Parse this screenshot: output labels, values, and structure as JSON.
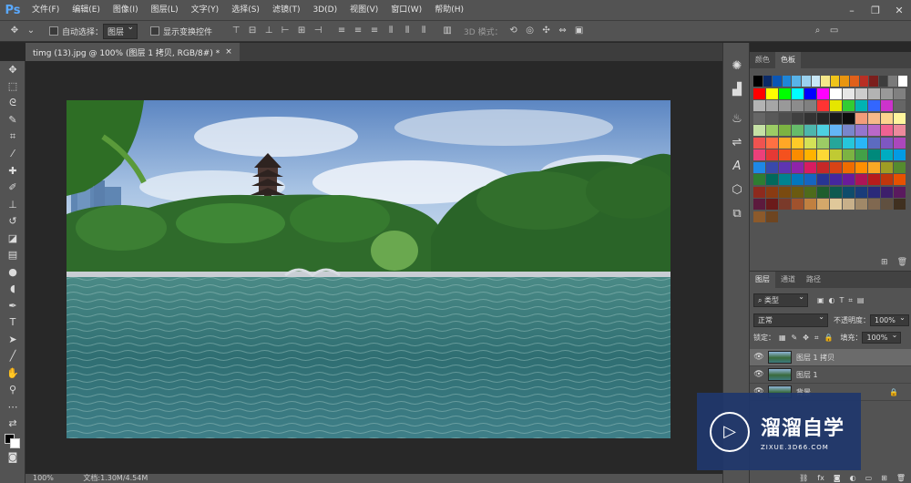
{
  "app": {
    "logo": "Ps"
  },
  "menu": [
    "文件(F)",
    "编辑(E)",
    "图像(I)",
    "图层(L)",
    "文字(Y)",
    "选择(S)",
    "滤镜(T)",
    "3D(D)",
    "视图(V)",
    "窗口(W)",
    "帮助(H)"
  ],
  "options": {
    "auto_select_label": "自动选择：",
    "auto_select_value": "图层",
    "show_transform_label": "显示变换控件",
    "mode_3d_label": "3D 模式："
  },
  "document": {
    "tab_title": "timg (13).jpg @ 100% (图层 1 拷贝, RGB/8#) *",
    "close": "×"
  },
  "status": {
    "zoom": "100%",
    "doc_info": "文档:1.30M/4.54M"
  },
  "swatch_panel": {
    "tabs": [
      "颜色",
      "色板"
    ],
    "active_tab": "色板"
  },
  "swatch_colors": [
    [
      "#000000",
      "#0b2a66",
      "#0a56b5",
      "#1e86d8",
      "#58b3e8",
      "#9ad1ee",
      "#c9e7f6",
      "#f5e78a",
      "#f0c419",
      "#e8950f",
      "#e0601a",
      "#b92f24",
      "#7b1f1d",
      "#3d3d3d",
      "#7a7a7a",
      "#ffffff"
    ],
    [
      "#ff0000",
      "#ffff00",
      "#00ff00",
      "#00ffff",
      "#0000ff",
      "#ff00ff",
      "#ffffff",
      "#e6e6e6",
      "#cccccc",
      "#b3b3b3",
      "#999999",
      "#808080"
    ],
    [
      "#b3b3b3",
      "#a6a6a6",
      "#999999",
      "#8c8c8c",
      "#808080",
      "#ff3333",
      "#e6e600",
      "#33cc33",
      "#00b3b3",
      "#3366ff",
      "#cc33cc",
      "#666666"
    ],
    [
      "#666666",
      "#595959",
      "#4d4d4d",
      "#404040",
      "#333333",
      "#262626",
      "#1a1a1a",
      "#0d0d0d",
      "#f29c7a",
      "#f7b98a",
      "#fcd48e",
      "#fff59d"
    ],
    [
      "#c5e1a5",
      "#9ccc65",
      "#7cb342",
      "#66bb6a",
      "#4db6ac",
      "#4dd0e1",
      "#64b5f6",
      "#7986cb",
      "#9575cd",
      "#ba68c8",
      "#f06292",
      "#ec8a9c"
    ],
    [
      "#ef5350",
      "#ff7043",
      "#ffa726",
      "#ffca28",
      "#d4e157",
      "#9ccc65",
      "#26a69a",
      "#26c6da",
      "#29b6f6",
      "#5c6bc0",
      "#7e57c2",
      "#ab47bc"
    ],
    [
      "#ec407a",
      "#e53935",
      "#f4511e",
      "#fb8c00",
      "#ffb300",
      "#fdd835",
      "#c0ca33",
      "#7cb342",
      "#43a047",
      "#00897b",
      "#00acc1",
      "#039be5"
    ],
    [
      "#1e88e5",
      "#3949ab",
      "#5e35b1",
      "#8e24aa",
      "#d81b60",
      "#c62828",
      "#d84315",
      "#ef6c00",
      "#ff8f00",
      "#f9a825",
      "#9e9d24",
      "#558b2f"
    ],
    [
      "#2e7d32",
      "#00695c",
      "#00838f",
      "#0277bd",
      "#1565c0",
      "#283593",
      "#4527a0",
      "#6a1b9a",
      "#ad1457",
      "#b71c1c",
      "#bf360c",
      "#e65100"
    ],
    [
      "#8d2a1e",
      "#8a3b12",
      "#7a4a10",
      "#6b5a10",
      "#4e6b1b",
      "#1f5e2e",
      "#0f5a50",
      "#0f4c6b",
      "#1a3c7a",
      "#2a2a7a",
      "#3d1f6b",
      "#5a1a5e"
    ],
    [
      "#5c1a3d",
      "#6b1a1a",
      "#7a3a2a",
      "#a0522d",
      "#c08040",
      "#d4a86a",
      "#e0c89a",
      "#c8b08a",
      "#a08868",
      "#806850",
      "#605040",
      "#403020"
    ],
    [
      "#8c5a2b",
      "#6e4520"
    ]
  ],
  "layers_panel": {
    "tabs": [
      "图层",
      "通道",
      "路径"
    ],
    "active_tab": "图层",
    "filter_label": "类型",
    "blend_mode": "正常",
    "opacity_label": "不透明度：",
    "opacity_value": "100%",
    "lock_label": "锁定：",
    "fill_label": "填充：",
    "fill_value": "100%",
    "layers": [
      {
        "name": "图层 1 拷贝",
        "selected": true
      },
      {
        "name": "图层 1",
        "selected": false
      },
      {
        "name": "背景",
        "selected": false
      }
    ],
    "footer_icons": [
      "link-icon",
      "fx-icon",
      "mask-icon",
      "adjustment-icon",
      "folder-icon",
      "new-layer-icon",
      "trash-icon"
    ]
  },
  "watermark": {
    "title": "溜溜自学",
    "url": "ZIXUE.3D66.COM"
  }
}
